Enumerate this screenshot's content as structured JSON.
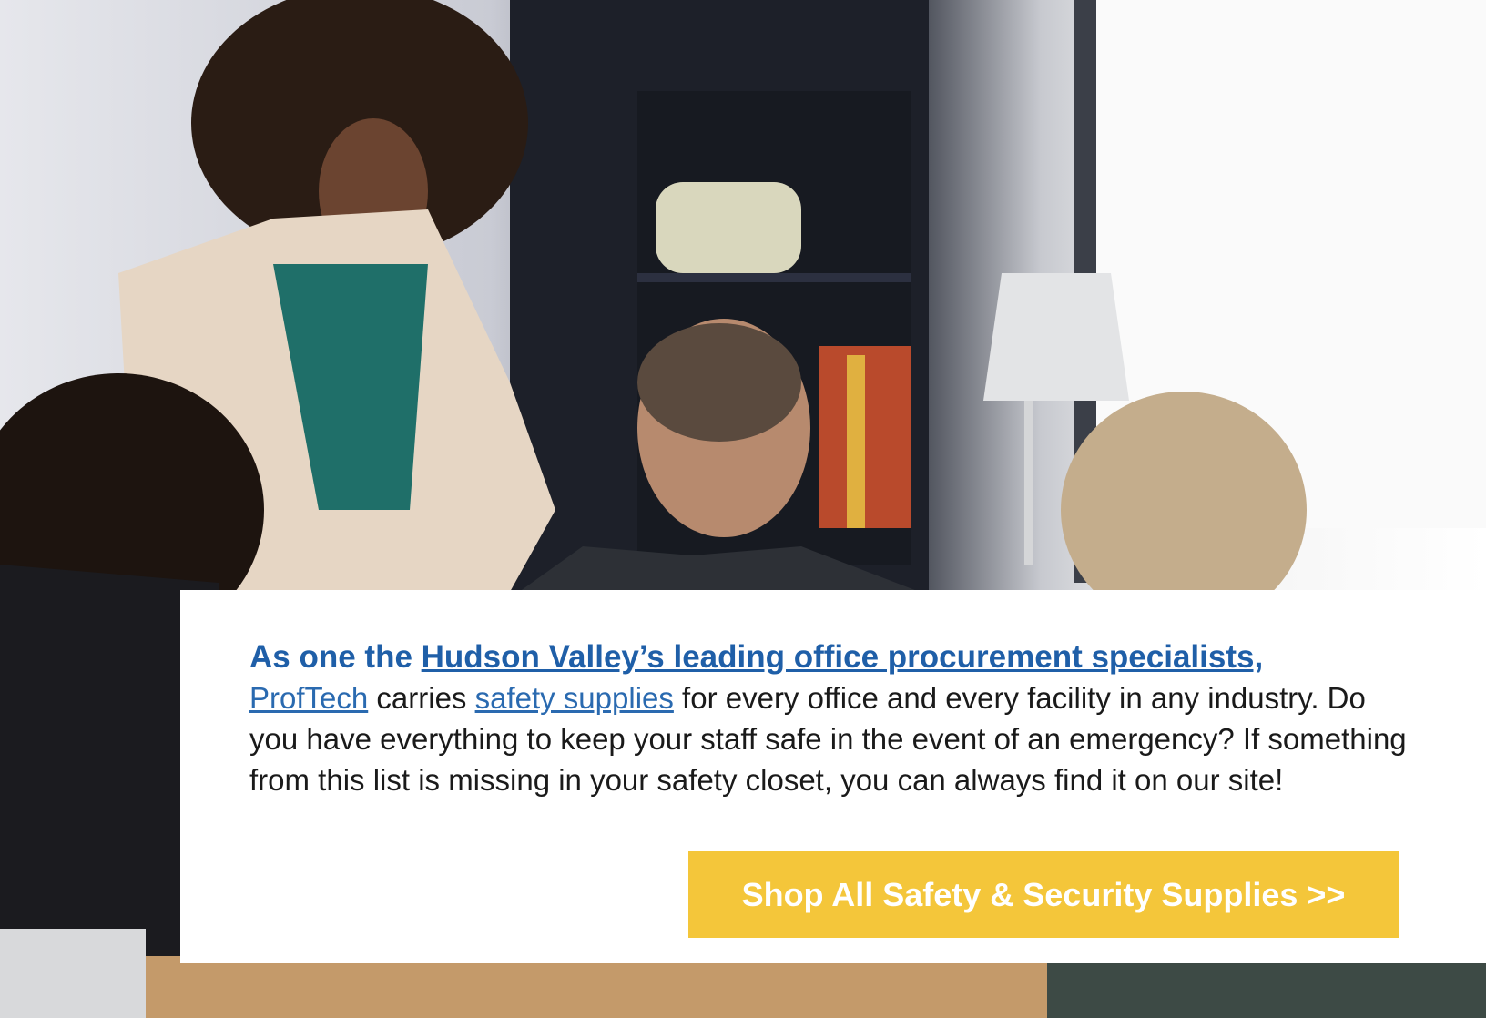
{
  "hero": {
    "image_label": "office team meeting photo"
  },
  "content": {
    "headline_prefix": "As one the ",
    "headline_link": "Hudson Valley’s leading office procurement specialists,",
    "company_link": "ProfTech",
    "text_carries": " carries ",
    "safety_link": "safety supplies",
    "text_rest": " for every office and every facility in any industry. Do you have everything to keep your staff safe in the event of an emergency? If something from this list is missing in your safety closet, you can always find it on our site!"
  },
  "cta": {
    "label": "Shop All Safety & Security Supplies >>"
  },
  "colors": {
    "headline": "#1f5fa8",
    "link": "#2a6ab0",
    "cta_background": "#f4c63a",
    "cta_text": "#ffffff"
  }
}
